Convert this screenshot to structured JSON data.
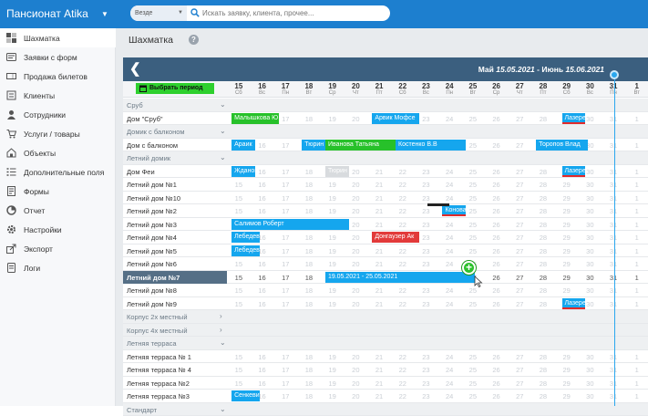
{
  "app": {
    "title": "Пансионат Atika"
  },
  "search": {
    "scope": "Везде",
    "placeholder": "Искать заявку, клиента, прочее..."
  },
  "sidebar": {
    "items": [
      {
        "label": "Шахматка",
        "icon": "chessboard-icon",
        "active": true
      },
      {
        "label": "Заявки с форм",
        "icon": "form-requests-icon"
      },
      {
        "label": "Продажа билетов",
        "icon": "ticket-icon"
      },
      {
        "label": "Клиенты",
        "icon": "clients-icon"
      },
      {
        "label": "Сотрудники",
        "icon": "staff-icon"
      },
      {
        "label": "Услуги / товары",
        "icon": "cart-icon"
      },
      {
        "label": "Объекты",
        "icon": "objects-icon"
      },
      {
        "label": "Дополнительные поля",
        "icon": "fields-icon"
      },
      {
        "label": "Формы",
        "icon": "forms-icon"
      },
      {
        "label": "Отчет",
        "icon": "report-icon"
      },
      {
        "label": "Настройки",
        "icon": "settings-icon"
      },
      {
        "label": "Экспорт",
        "icon": "export-icon"
      },
      {
        "label": "Логи",
        "icon": "logs-icon"
      }
    ]
  },
  "page": {
    "title": "Шахматка",
    "help": "?"
  },
  "calendar": {
    "period_label": "Май",
    "period_from": "15.05.2021",
    "period_sep": "- Июнь",
    "period_to": "15.06.2021",
    "pick_period": "Выбрать период",
    "days": [
      {
        "n": "15",
        "w": "Сб"
      },
      {
        "n": "16",
        "w": "Вс"
      },
      {
        "n": "17",
        "w": "Пн"
      },
      {
        "n": "18",
        "w": "Вт"
      },
      {
        "n": "19",
        "w": "Ср"
      },
      {
        "n": "20",
        "w": "Чт"
      },
      {
        "n": "21",
        "w": "Пт"
      },
      {
        "n": "22",
        "w": "Сб"
      },
      {
        "n": "23",
        "w": "Вс"
      },
      {
        "n": "24",
        "w": "Пн"
      },
      {
        "n": "25",
        "w": "Вт"
      },
      {
        "n": "26",
        "w": "Ср"
      },
      {
        "n": "27",
        "w": "Чт"
      },
      {
        "n": "28",
        "w": "Пт"
      },
      {
        "n": "29",
        "w": "Сб"
      },
      {
        "n": "30",
        "w": "Вс"
      },
      {
        "n": "31",
        "w": "Пн"
      },
      {
        "n": "1",
        "w": "Вт"
      }
    ]
  },
  "rows": [
    {
      "label": "Сруб",
      "type": "group"
    },
    {
      "label": "Дом \"Сруб\"",
      "bookings": [
        {
          "text": "Малышкова Ю",
          "start": 0.2,
          "len": 2,
          "color": "green"
        },
        {
          "text": "Арвик Мофсе",
          "start": 6.2,
          "len": 2,
          "color": "blue"
        },
        {
          "text": "Лазере",
          "start": 14.3,
          "len": 1,
          "color": "blue",
          "underline": true
        }
      ]
    },
    {
      "label": "Домик с балконом",
      "type": "group"
    },
    {
      "label": "Дом с балконом",
      "bookings": [
        {
          "text": "Араик",
          "start": 0.2,
          "len": 1,
          "color": "blue"
        },
        {
          "text": "Тюрин",
          "start": 3.2,
          "len": 1,
          "color": "blue"
        },
        {
          "text": "Иванова Татьяна",
          "start": 4.2,
          "len": 3,
          "color": "green"
        },
        {
          "text": "Костенко В.В",
          "start": 7.2,
          "len": 3,
          "color": "blue"
        },
        {
          "text": "Торопов Влад",
          "start": 13.2,
          "len": 2.2,
          "color": "blue"
        }
      ]
    },
    {
      "label": "Летний домик",
      "type": "group"
    },
    {
      "label": "Дом Феи",
      "bookings": [
        {
          "text": "Жданов",
          "start": 0.2,
          "len": 1,
          "color": "blue"
        },
        {
          "text": "Тюрин",
          "start": 4.2,
          "len": 1,
          "color": "grey"
        },
        {
          "text": "Лазере",
          "start": 14.3,
          "len": 1,
          "color": "blue",
          "underline": true
        }
      ]
    },
    {
      "label": "Летний дом №1",
      "bookings": []
    },
    {
      "label": "Летний дом №10",
      "bookings": []
    },
    {
      "label": "Летний дом №2",
      "bookings": [
        {
          "text": "Коновал",
          "start": 9.2,
          "len": 1,
          "color": "blue",
          "underline": true
        }
      ]
    },
    {
      "label": "Летний дом №3",
      "bookings": [
        {
          "text": "Салимов Роберт",
          "start": 0.2,
          "len": 5,
          "color": "blue"
        }
      ]
    },
    {
      "label": "Летний дом №4",
      "bookings": [
        {
          "text": "Лебедев",
          "start": 0.2,
          "len": 1.2,
          "color": "blue"
        },
        {
          "text": "Донгаузер Ак",
          "start": 6.2,
          "len": 2,
          "color": "red"
        }
      ]
    },
    {
      "label": "Летний дом №5",
      "bookings": [
        {
          "text": "Лебедев",
          "start": 0.2,
          "len": 1.2,
          "color": "blue"
        }
      ]
    },
    {
      "label": "Летний дом №6",
      "bookings": []
    },
    {
      "label": "Летний дом №7",
      "selected": true,
      "bookings": [
        {
          "text": "19.05.2021 - 25.05.2021",
          "start": 4.2,
          "len": 6.4,
          "color": "blue"
        }
      ]
    },
    {
      "label": "Летний дом №8",
      "bookings": []
    },
    {
      "label": "Летний дом №9",
      "bookings": [
        {
          "text": "Лазере",
          "start": 14.3,
          "len": 1,
          "color": "blue",
          "underline": true
        }
      ]
    },
    {
      "label": "Корпус 2х местный",
      "type": "group",
      "collapsed": true
    },
    {
      "label": "Корпус 4х местный",
      "type": "group",
      "collapsed": true
    },
    {
      "label": "Летняя терраса",
      "type": "group"
    },
    {
      "label": "Летняя терраса № 1",
      "bookings": []
    },
    {
      "label": "Летняя терраса № 4",
      "bookings": []
    },
    {
      "label": "Летняя терраса №2",
      "bookings": []
    },
    {
      "label": "Летняя терраса №3",
      "bookings": [
        {
          "text": "Сенкевич",
          "start": 0.2,
          "len": 1.2,
          "color": "blue"
        }
      ]
    },
    {
      "label": "Стандарт",
      "type": "group"
    }
  ]
}
